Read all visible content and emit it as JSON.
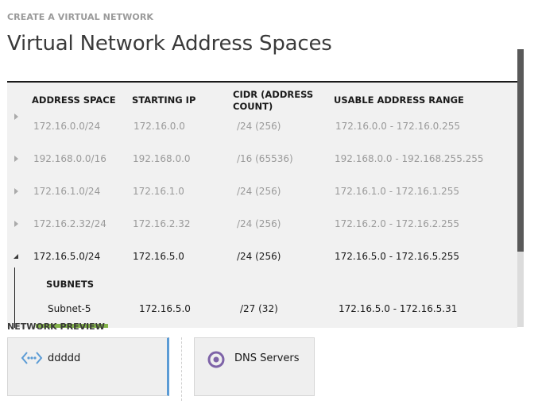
{
  "breadcrumb": "CREATE A VIRTUAL NETWORK",
  "page_title": "Virtual Network Address Spaces",
  "table": {
    "headers": {
      "address_space": "ADDRESS SPACE",
      "starting_ip": "STARTING IP",
      "cidr_line1": "CIDR (ADDRESS",
      "cidr_line2": "COUNT)",
      "usable_range": "USABLE ADDRESS RANGE"
    },
    "rows": [
      {
        "address_space": "172.16.0.0/24",
        "starting_ip": "172.16.0.0",
        "cidr": "/24 (256)",
        "usable_range": "172.16.0.0 - 172.16.0.255"
      },
      {
        "address_space": "192.168.0.0/16",
        "starting_ip": "192.168.0.0",
        "cidr": "/16 (65536)",
        "usable_range": "192.168.0.0 - 192.168.255.255"
      },
      {
        "address_space": "172.16.1.0/24",
        "starting_ip": "172.16.1.0",
        "cidr": "/24 (256)",
        "usable_range": "172.16.1.0 - 172.16.1.255"
      },
      {
        "address_space": "172.16.2.32/24",
        "starting_ip": "172.16.2.32",
        "cidr": "/24 (256)",
        "usable_range": "172.16.2.0 - 172.16.2.255"
      },
      {
        "address_space": "172.16.5.0/24",
        "starting_ip": "172.16.5.0",
        "cidr": "/24 (256)",
        "usable_range": "172.16.5.0 - 172.16.5.255"
      }
    ],
    "subnets_heading": "SUBNETS",
    "subnet": {
      "name": "Subnet-5",
      "starting_ip": "172.16.5.0",
      "cidr": "/27 (32)",
      "usable_range": "172.16.5.0 - 172.16.5.31"
    }
  },
  "network_preview": {
    "label": "NETWORK PREVIEW",
    "cards": [
      {
        "label": "ddddd",
        "icon": "virtual-network-icon"
      },
      {
        "label": "DNS Servers",
        "icon": "dns-server-icon"
      }
    ]
  },
  "colors": {
    "accent_blue": "#5b9bd5",
    "accent_green": "#84b34b",
    "dns_purple": "#7e63a8"
  }
}
